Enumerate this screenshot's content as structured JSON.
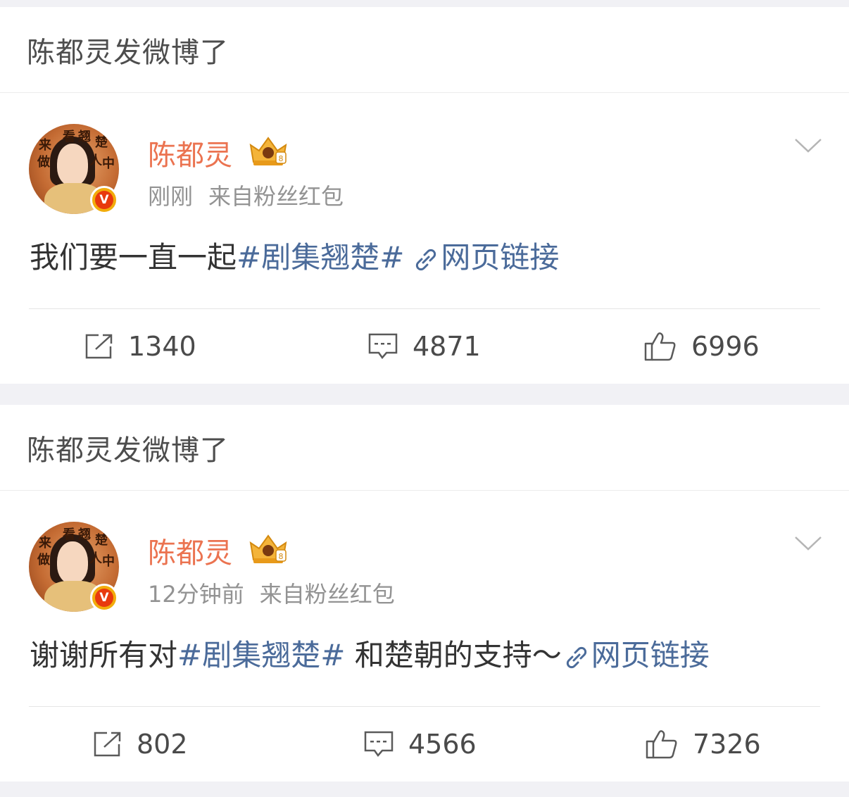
{
  "posts": [
    {
      "header": "陈都灵发微博了",
      "user": {
        "name": "陈都灵",
        "verified_badge": "V"
      },
      "time": "刚刚",
      "source": "来自粉丝红包",
      "content": {
        "text_before": "我们要一直一起",
        "topic": "#剧集翘楚#",
        "text_after": "",
        "link_label": "网页链接"
      },
      "actions": {
        "reposts": "1340",
        "comments": "4871",
        "likes": "6996"
      }
    },
    {
      "header": "陈都灵发微博了",
      "user": {
        "name": "陈都灵",
        "verified_badge": "V"
      },
      "time": "12分钟前",
      "source": "来自粉丝红包",
      "content": {
        "text_before": "谢谢所有对",
        "topic": "#剧集翘楚#",
        "text_after": " 和楚朝的支持～",
        "link_label": "网页链接"
      },
      "actions": {
        "reposts": "802",
        "comments": "4566",
        "likes": "7326"
      }
    }
  ],
  "avatar_text": [
    "来",
    "看",
    "翘",
    "楚",
    "做",
    "人",
    "中"
  ],
  "colors": {
    "username": "#eb7350",
    "link": "#4b6b9a",
    "meta": "#939393"
  },
  "icons": [
    "crown-icon",
    "chevron-down-icon",
    "repost-icon",
    "comment-icon",
    "like-icon",
    "link-icon"
  ]
}
